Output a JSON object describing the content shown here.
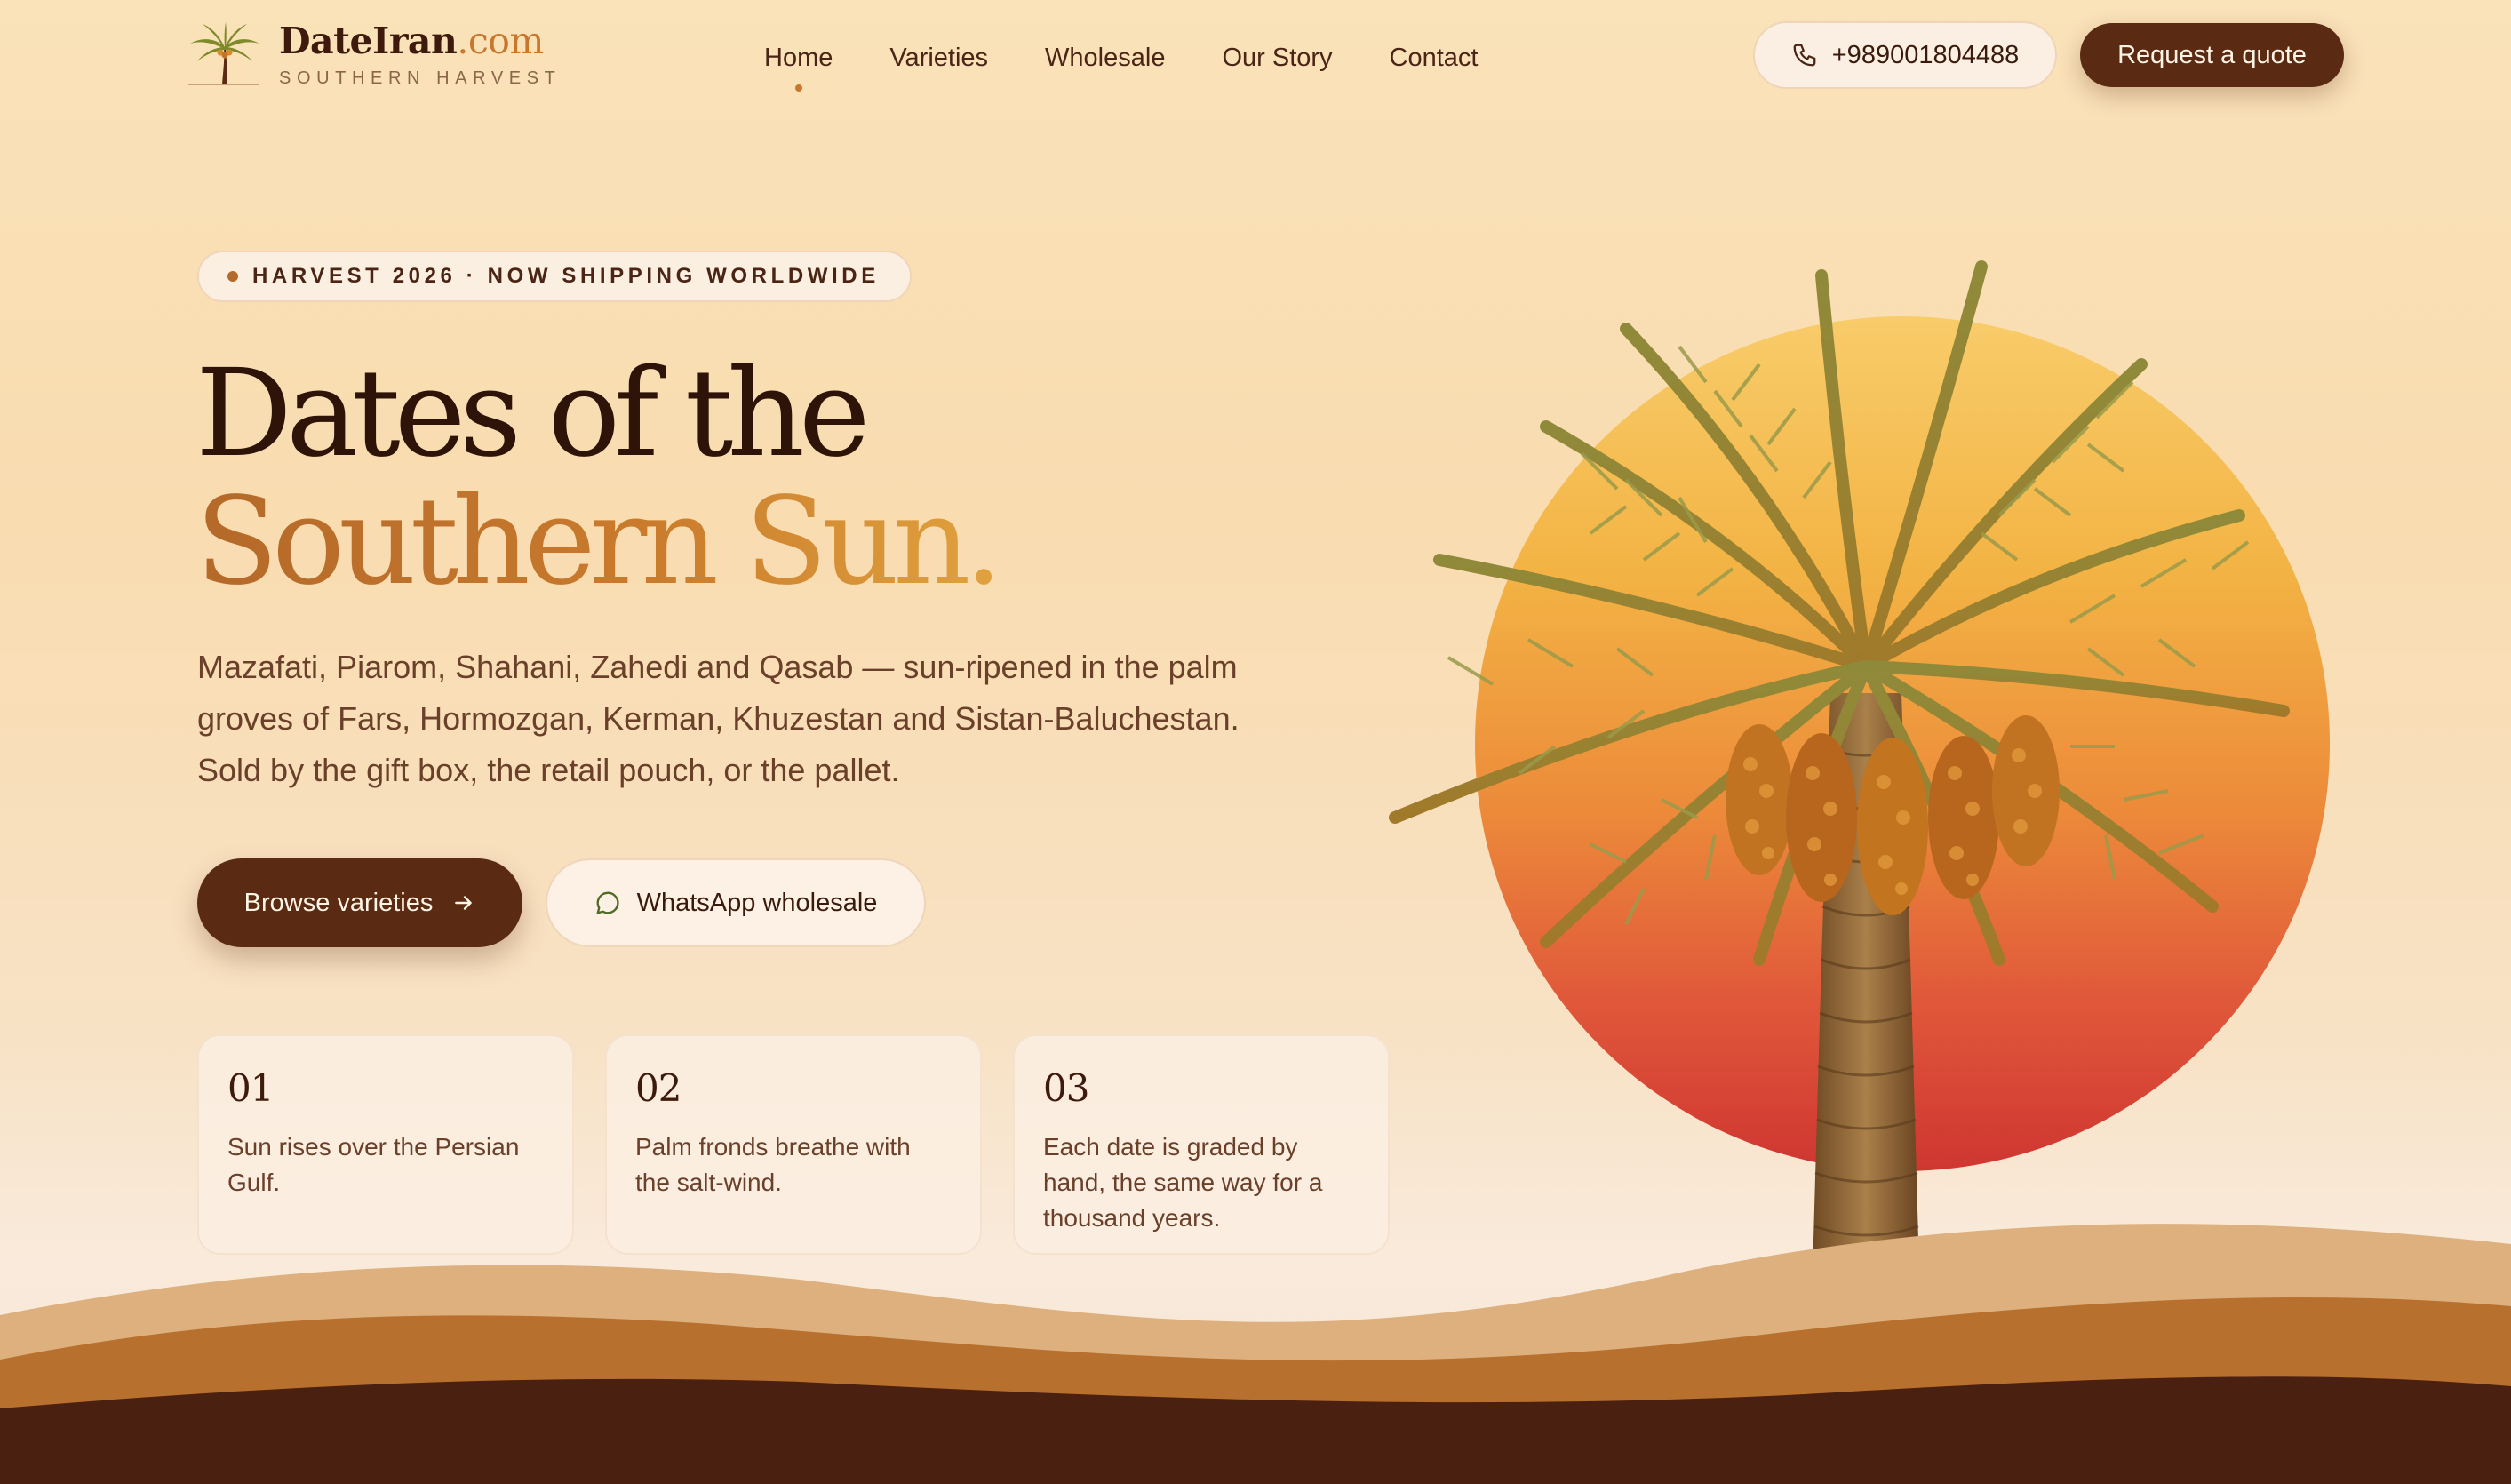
{
  "header": {
    "brand_name": "DateIran",
    "brand_domain": ".com",
    "tagline": "SOUTHERN HARVEST",
    "nav": [
      {
        "label": "Home",
        "active": true
      },
      {
        "label": "Varieties",
        "active": false
      },
      {
        "label": "Wholesale",
        "active": false
      },
      {
        "label": "Our Story",
        "active": false
      },
      {
        "label": "Contact",
        "active": false
      }
    ],
    "phone": "+989001804488",
    "cta": "Request a quote"
  },
  "hero": {
    "badge": "HARVEST 2026 · NOW SHIPPING WORLDWIDE",
    "title_line1": "Dates of the",
    "title_line2": "Southern Sun.",
    "description": "Mazafati, Piarom, Shahani, Zahedi and Qasab — sun-ripened in the palm groves of Fars, Hormozgan, Kerman, Khuzestan and Sistan-Baluchestan. Sold by the gift box, the retail pouch, or the pallet.",
    "primary_cta": "Browse varieties",
    "secondary_cta": "WhatsApp wholesale"
  },
  "steps": [
    {
      "number": "01",
      "text": "Sun rises over the Persian Gulf."
    },
    {
      "number": "02",
      "text": "Palm fronds breathe with the salt-wind."
    },
    {
      "number": "03",
      "text": "Each date is graded by hand, the same way for a thousand years."
    }
  ],
  "colors": {
    "brand_dark": "#5a2a12",
    "accent": "#c9772f",
    "sun_top": "#f8cc6a",
    "sun_bottom": "#cf3631"
  },
  "icons": {
    "logo": "palm-tree-icon",
    "phone": "phone-icon",
    "arrow": "arrow-right-icon",
    "chat": "chat-bubble-icon"
  }
}
